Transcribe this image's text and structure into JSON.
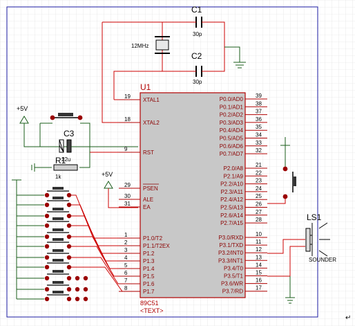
{
  "components": {
    "c1": {
      "ref": "C1",
      "value": "30p"
    },
    "c2": {
      "ref": "C2",
      "value": "30p"
    },
    "xtal": {
      "value": "12MHz"
    },
    "c3": {
      "ref": "C3",
      "value": "22u"
    },
    "r1": {
      "ref": "R1",
      "value": "1k"
    },
    "u1": {
      "ref": "U1",
      "part": "89C51",
      "text": "<TEXT>"
    },
    "ls1": {
      "ref": "LS1",
      "part": "SOUNDER"
    },
    "supply": {
      "vcc": "+5V"
    }
  },
  "pins_left": [
    {
      "num": "19",
      "name": "XTAL1"
    },
    {
      "num": "18",
      "name": "XTAL2"
    },
    {
      "num": "9",
      "name": "RST"
    },
    {
      "num": "29",
      "name": "PSEN"
    },
    {
      "num": "30",
      "name": "ALE"
    },
    {
      "num": "31",
      "name": "EA"
    },
    {
      "num": "1",
      "name": "P1.0/T2"
    },
    {
      "num": "2",
      "name": "P1.1/T2EX"
    },
    {
      "num": "3",
      "name": "P1.2"
    },
    {
      "num": "4",
      "name": "P1.3"
    },
    {
      "num": "5",
      "name": "P1.4"
    },
    {
      "num": "6",
      "name": "P1.5"
    },
    {
      "num": "7",
      "name": "P1.6"
    },
    {
      "num": "8",
      "name": "P1.7"
    }
  ],
  "pins_right": [
    {
      "num": "39",
      "name": "P0.0/AD0"
    },
    {
      "num": "38",
      "name": "P0.1/AD1"
    },
    {
      "num": "37",
      "name": "P0.2/AD2"
    },
    {
      "num": "36",
      "name": "P0.3/AD3"
    },
    {
      "num": "35",
      "name": "P0.4/AD4"
    },
    {
      "num": "34",
      "name": "P0.5/AD5"
    },
    {
      "num": "33",
      "name": "P0.6/AD6"
    },
    {
      "num": "32",
      "name": "P0.7/AD7"
    },
    {
      "num": "21",
      "name": "P2.0/A8"
    },
    {
      "num": "22",
      "name": "P2.1/A9"
    },
    {
      "num": "23",
      "name": "P2.2/A10"
    },
    {
      "num": "24",
      "name": "P2.3/A11"
    },
    {
      "num": "25",
      "name": "P2.4/A12"
    },
    {
      "num": "26",
      "name": "P2.5/A13"
    },
    {
      "num": "27",
      "name": "P2.6/A14"
    },
    {
      "num": "28",
      "name": "P2.7/A15"
    },
    {
      "num": "10",
      "name": "P3.0/RXD"
    },
    {
      "num": "11",
      "name": "P3.1/TXD"
    },
    {
      "num": "12",
      "name": "P3.2/INT0"
    },
    {
      "num": "13",
      "name": "P3.3/INT1"
    },
    {
      "num": "14",
      "name": "P3.4/T0"
    },
    {
      "num": "15",
      "name": "P3.5/T1"
    },
    {
      "num": "16",
      "name": "P3.6/WR"
    },
    {
      "num": "17",
      "name": "P3.7/RD"
    }
  ],
  "colors": {
    "grid": "#dcdcdc",
    "frame": "#1a1aa0",
    "wire": "#cc0000",
    "net": "#1a5c1a",
    "chip_fill": "#c8c8c8",
    "pin": "#b00000"
  },
  "page": {
    "corner_mark": "↵"
  }
}
